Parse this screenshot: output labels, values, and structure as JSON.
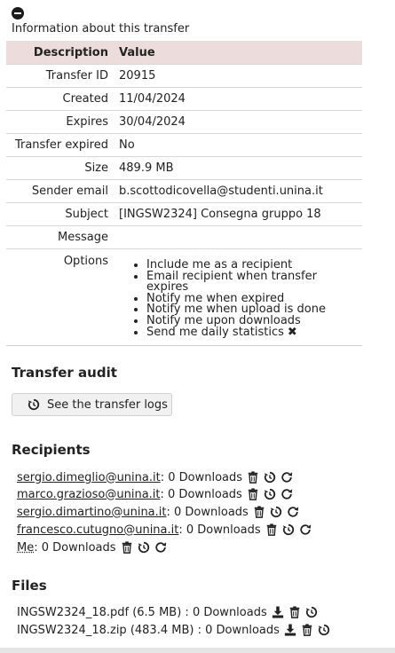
{
  "info": {
    "title": "Information about this transfer"
  },
  "table": {
    "header": {
      "description": "Description",
      "value": "Value"
    },
    "rows": [
      {
        "label": "Transfer ID",
        "value": "20915"
      },
      {
        "label": "Created",
        "value": "11/04/2024"
      },
      {
        "label": "Expires",
        "value": "30/04/2024"
      },
      {
        "label": "Transfer expired",
        "value": "No"
      },
      {
        "label": "Size",
        "value": "489.9 MB"
      },
      {
        "label": "Sender email",
        "value": "b.scottodicovella@studenti.unina.it"
      },
      {
        "label": "Subject",
        "value": "[INGSW2324] Consegna gruppo 18"
      },
      {
        "label": "Message",
        "value": ""
      }
    ],
    "options": {
      "label": "Options",
      "items": [
        "Include me as a recipient",
        "Email recipient when transfer expires",
        "Notify me when expired",
        "Notify me when upload is done",
        "Notify me upon downloads",
        "Send me daily statistics"
      ]
    }
  },
  "audit": {
    "heading": "Transfer audit",
    "button": "See the transfer logs"
  },
  "recipients": {
    "heading": "Recipients",
    "items": [
      {
        "email": "sergio.dimeglio@unina.it",
        "downloads": " : 0 Downloads"
      },
      {
        "email": "marco.grazioso@unina.it",
        "downloads": " : 0 Downloads"
      },
      {
        "email": "sergio.dimartino@unina.it",
        "downloads": " : 0 Downloads"
      },
      {
        "email": "francesco.cutugno@unina.it",
        "downloads": " : 0 Downloads"
      },
      {
        "email": "Me",
        "downloads": " : 0 Downloads"
      }
    ]
  },
  "files": {
    "heading": "Files",
    "items": [
      {
        "name": "INGSW2324_18.pdf (6.5 MB) : 0 Downloads"
      },
      {
        "name": "INGSW2324_18.zip (483.4 MB) : 0 Downloads"
      }
    ]
  },
  "icons": {
    "toggle": "minus-circle-icon",
    "logs": "history-icon",
    "delete": "trash-icon",
    "history": "history-icon",
    "resend": "refresh-icon",
    "download": "download-icon",
    "option_disabled": "close-icon"
  }
}
